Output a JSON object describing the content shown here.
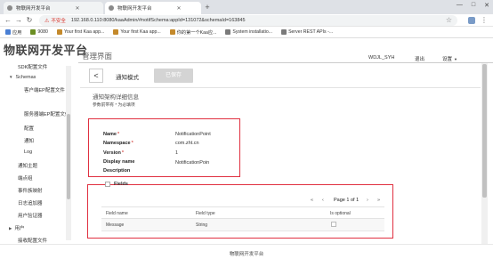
{
  "browser": {
    "tabs": [
      {
        "title": "物联网开发平台",
        "active": false
      },
      {
        "title": "物联网开发平台",
        "active": true
      }
    ],
    "window_controls": [
      "—",
      "□",
      "✕"
    ],
    "insecure_label": "不安全",
    "url": "192.168.0.110:8080/kaaAdmin/#notifSchema:appId=131072&schemaId=163845",
    "bookmarks": [
      {
        "label": "应用",
        "color": "#4a7fd4"
      },
      {
        "label": "9080",
        "color": "#6b8e23"
      },
      {
        "label": "Your first Kaa app...",
        "color": "#c4892b"
      },
      {
        "label": "Your first Kaa app...",
        "color": "#c4892b"
      },
      {
        "label": "你的第一个Kaa应...",
        "color": "#c4892b"
      },
      {
        "label": "System installatio...",
        "color": "#7a7a7a"
      },
      {
        "label": "Server REST APIs -...",
        "color": "#7a7a7a"
      }
    ]
  },
  "header": {
    "logo": "物联网开发平台",
    "section_title": "管理界面",
    "user": "WDJL_SYH",
    "logout": "退出",
    "settings": "设置"
  },
  "sidebar": {
    "items": [
      {
        "label": "SDK配置文件",
        "indent": 1,
        "arrow": ""
      },
      {
        "label": "Schemas",
        "indent": 1,
        "arrow": "▼"
      },
      {
        "label": "客户端EP配置文件",
        "indent": 2,
        "arrow": ""
      },
      {
        "label": "服务器端EP配置文件",
        "indent": 2,
        "arrow": ""
      },
      {
        "label": "配置",
        "indent": 2,
        "arrow": ""
      },
      {
        "label": "通知",
        "indent": 2,
        "arrow": ""
      },
      {
        "label": "Log",
        "indent": 2,
        "arrow": ""
      },
      {
        "label": "通知主题",
        "indent": 1,
        "arrow": ""
      },
      {
        "label": "端点组",
        "indent": 1,
        "arrow": ""
      },
      {
        "label": "事件族映射",
        "indent": 1,
        "arrow": ""
      },
      {
        "label": "日志追加器",
        "indent": 1,
        "arrow": ""
      },
      {
        "label": "用户验证器",
        "indent": 1,
        "arrow": ""
      },
      {
        "label": "用户",
        "indent": 0,
        "arrow": "▶"
      },
      {
        "label": "接收配置文件",
        "indent": 1,
        "arrow": ""
      }
    ]
  },
  "toolbar": {
    "back": "<",
    "title": "通知模式",
    "saved": "已保存"
  },
  "details": {
    "heading": "通知架构详细信息",
    "required_hint": "参数前带有 * 为必填项",
    "fields": [
      {
        "label": "Name",
        "required": true,
        "value": "NotificationPoint"
      },
      {
        "label": "Namespace",
        "required": true,
        "value": "com.zht.cn"
      },
      {
        "label": "Version",
        "required": true,
        "value": "1"
      },
      {
        "label": "Display name",
        "required": false,
        "value": "NotificationPoin"
      },
      {
        "label": "Description",
        "required": false,
        "value": ""
      }
    ]
  },
  "fields_table": {
    "title": "Fields",
    "pager": {
      "first": "«",
      "prev": "‹",
      "info": "Page 1 of 1",
      "next": "›",
      "last": "»"
    },
    "columns": [
      "Field name",
      "Field type",
      "Is optional"
    ],
    "rows": [
      {
        "name": "Message",
        "type": "String",
        "optional": false
      }
    ]
  },
  "footer": {
    "text": "物联网开发平台"
  }
}
